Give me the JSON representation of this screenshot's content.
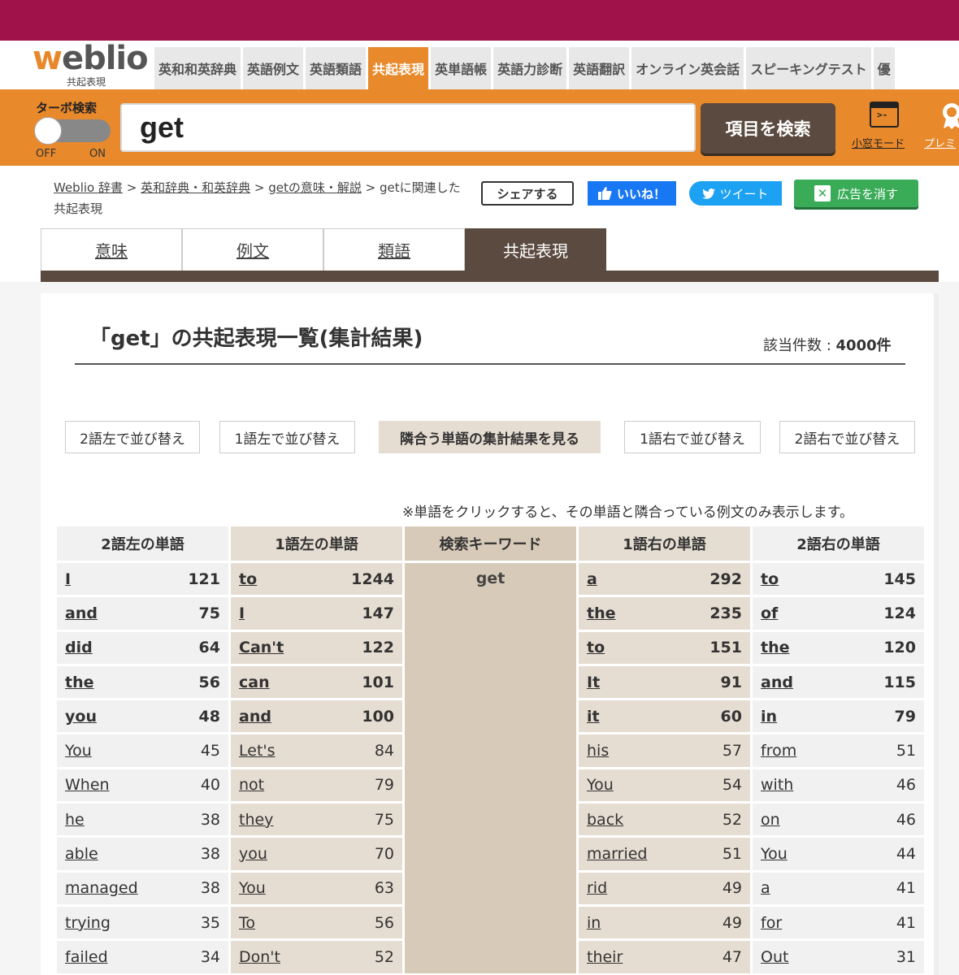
{
  "colors": {
    "topbar": "#9f134a",
    "accent": "#e8892b",
    "dark_brown": "#5a4a3f",
    "facebook": "#1877f2",
    "twitter": "#1da1f2",
    "ad_green": "#3aac58"
  },
  "header": {
    "logo_prefix": "w",
    "logo_rest": "eblio",
    "logo_sub": "共起表現",
    "nav": [
      "英和和英辞典",
      "英語例文",
      "英語類語",
      "共起表現",
      "英単語帳",
      "英語力診断",
      "英語翻訳",
      "オンライン英会話",
      "スピーキングテスト",
      "優"
    ],
    "active_nav": "共起表現"
  },
  "search": {
    "turbo_label": "ターボ検索",
    "toggle_off": "OFF",
    "toggle_on": "ON",
    "query": "get",
    "button": "項目を検索",
    "mini_icon_text": ">-",
    "mini_mode": "小窓モード",
    "premium": "プレミ"
  },
  "breadcrumb": {
    "items": [
      "Weblio 辞書",
      "英和辞典・和英辞典",
      "getの意味・解説"
    ],
    "sep": " > ",
    "current": "getに関連した共起表現"
  },
  "social": {
    "share": "シェアする",
    "like": "いいね！",
    "tweet": "ツイート",
    "ad": "広告を消す"
  },
  "tabs": [
    "意味",
    "例文",
    "類語",
    "共起表現"
  ],
  "result": {
    "title": "「get」の共起表現一覧(集計結果)",
    "count_label": "該当件数 : ",
    "count_value": "4000件"
  },
  "sort_buttons": [
    "2語左で並び替え",
    "1語左で並び替え",
    "隣合う単語の集計結果を見る",
    "1語右で並び替え",
    "2語右で並び替え"
  ],
  "note": "※単語をクリックすると、その単語と隣合っている例文のみ表示します。",
  "table": {
    "headers": [
      "2語左の単語",
      "1語左の単語",
      "検索キーワード",
      "1語右の単語",
      "2語右の単語"
    ],
    "keyword": "get",
    "left2": [
      [
        "I",
        "121"
      ],
      [
        "and",
        "75"
      ],
      [
        "did",
        "64"
      ],
      [
        "the",
        "56"
      ],
      [
        "you",
        "48"
      ],
      [
        "You",
        "45"
      ],
      [
        "When",
        "40"
      ],
      [
        "he",
        "38"
      ],
      [
        "able",
        "38"
      ],
      [
        "managed",
        "38"
      ],
      [
        "trying",
        "35"
      ],
      [
        "failed",
        "34"
      ]
    ],
    "left1": [
      [
        "to",
        "1244"
      ],
      [
        "I",
        "147"
      ],
      [
        "Can't",
        "122"
      ],
      [
        "can",
        "101"
      ],
      [
        "and",
        "100"
      ],
      [
        "Let's",
        "84"
      ],
      [
        "not",
        "79"
      ],
      [
        "they",
        "75"
      ],
      [
        "you",
        "70"
      ],
      [
        "You",
        "63"
      ],
      [
        "To",
        "56"
      ],
      [
        "Don't",
        "52"
      ]
    ],
    "right1": [
      [
        "a",
        "292"
      ],
      [
        "the",
        "235"
      ],
      [
        "to",
        "151"
      ],
      [
        "It",
        "91"
      ],
      [
        "it",
        "60"
      ],
      [
        "his",
        "57"
      ],
      [
        "You",
        "54"
      ],
      [
        "back",
        "52"
      ],
      [
        "married",
        "51"
      ],
      [
        "rid",
        "49"
      ],
      [
        "in",
        "49"
      ],
      [
        "their",
        "47"
      ]
    ],
    "right2": [
      [
        "to",
        "145"
      ],
      [
        "of",
        "124"
      ],
      [
        "the",
        "120"
      ],
      [
        "and",
        "115"
      ],
      [
        "in",
        "79"
      ],
      [
        "from",
        "51"
      ],
      [
        "with",
        "46"
      ],
      [
        "on",
        "46"
      ],
      [
        "You",
        "44"
      ],
      [
        "a",
        "41"
      ],
      [
        "for",
        "41"
      ],
      [
        "Out",
        "31"
      ]
    ]
  }
}
